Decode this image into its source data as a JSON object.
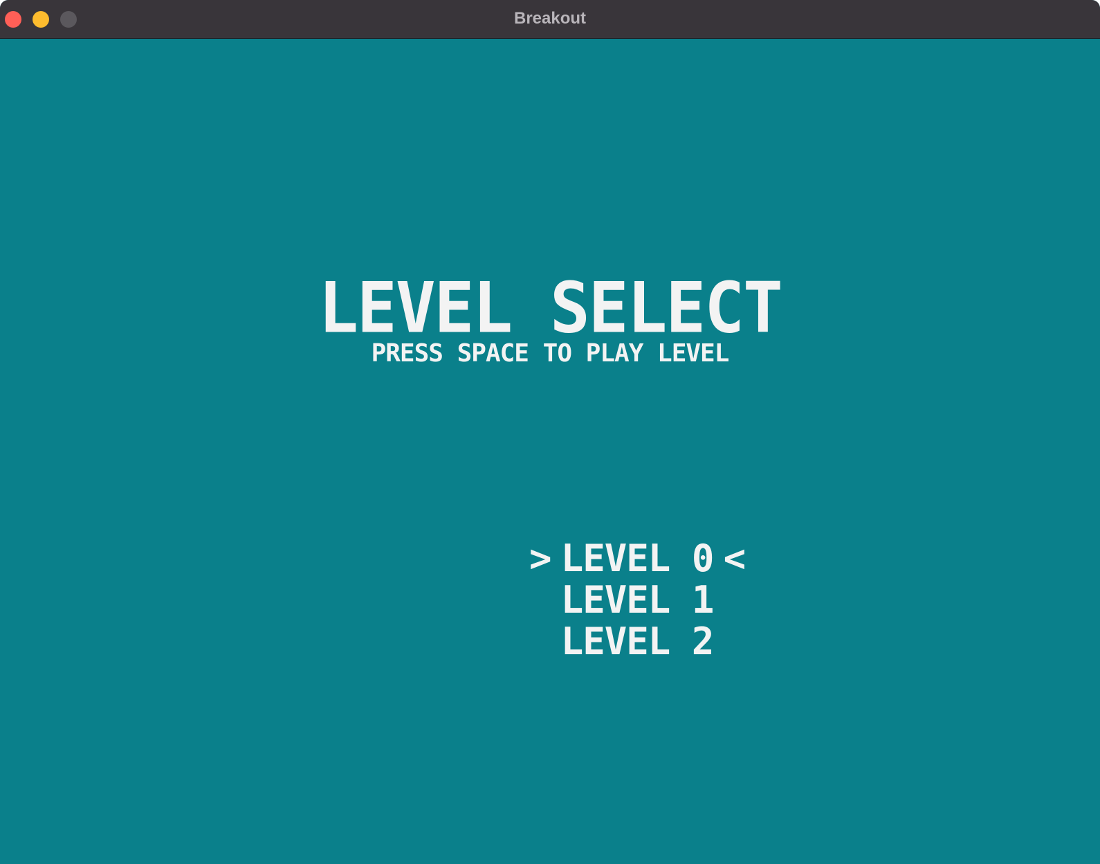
{
  "window": {
    "title": "Breakout",
    "controls": {
      "close": "close-button",
      "minimize": "minimize-button",
      "zoom": "zoom-button"
    }
  },
  "colors": {
    "background": "#0a808b",
    "foreground": "#f3f3f3",
    "titlebar": "#39353a"
  },
  "screen": {
    "heading": "LEVEL SELECT",
    "subheading": "PRESS SPACE TO PLAY LEVEL"
  },
  "levels": {
    "selected_index": 0,
    "selector_left": ">",
    "selector_right": "<",
    "items": [
      {
        "label": "LEVEL 0"
      },
      {
        "label": "LEVEL 1"
      },
      {
        "label": "LEVEL 2"
      }
    ]
  }
}
